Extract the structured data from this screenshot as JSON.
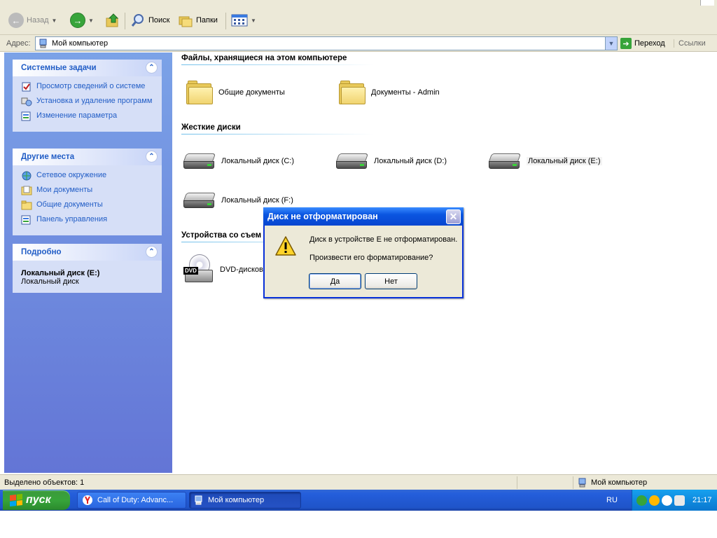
{
  "toolbar": {
    "back_label": "Назад",
    "search_label": "Поиск",
    "folders_label": "Папки"
  },
  "addressbar": {
    "label": "Адрес:",
    "value": "Мой компьютер",
    "go_label": "Переход",
    "links_label": "Ссылки"
  },
  "taskpane": {
    "system_tasks": {
      "title": "Системные задачи",
      "items": [
        "Просмотр сведений о системе",
        "Установка и удаление программ",
        "Изменение параметра"
      ]
    },
    "other_places": {
      "title": "Другие места",
      "items": [
        "Сетевое окружение",
        "Мои документы",
        "Общие документы",
        "Панель управления"
      ]
    },
    "details": {
      "title": "Подробно",
      "name": "Локальный диск (E:)",
      "type": "Локальный диск"
    }
  },
  "content": {
    "groups": [
      {
        "title": "Файлы, хранящиеся на этом компьютере",
        "items": [
          "Общие документы",
          "Документы - Admin"
        ]
      },
      {
        "title": "Жесткие диски",
        "items": [
          "Локальный диск (C:)",
          "Локальный диск (D:)",
          "Локальный диск (E:)",
          "Локальный диск (F:)"
        ]
      },
      {
        "title": "Устройства со съем",
        "items": [
          "DVD-дисково"
        ]
      }
    ],
    "dvd_badge": "DVD"
  },
  "dialog": {
    "title": "Диск не отформатирован",
    "message1": "Диск в устройстве E не отформатирован.",
    "message2": "Произвести его форматирование?",
    "yes_label": "Да",
    "no_label": "Нет"
  },
  "statusbar": {
    "left": "Выделено объектов: 1",
    "right": "Мой компьютер"
  },
  "taskbar": {
    "start_label": "пуск",
    "tasks": [
      "Call of Duty: Advanc...",
      "Мой компьютер"
    ],
    "lang": "RU",
    "clock": "21:17"
  },
  "colors": {
    "taskpane_link": "#215dc6",
    "taskbar": "#245edb",
    "start_green": "#37a43a",
    "dialog_title": "#0a55e0"
  }
}
